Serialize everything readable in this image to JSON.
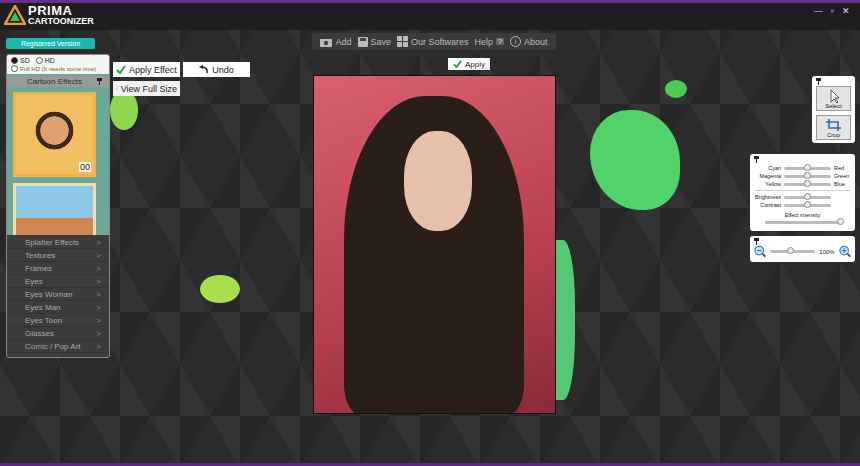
{
  "window": {
    "title_main": "PRIMA",
    "title_sub": "CARTOONIZER",
    "controls": [
      "—",
      "▫",
      "✕"
    ]
  },
  "toolbar": [
    {
      "label": "Add",
      "kind": "camera",
      "glyph": ""
    },
    {
      "label": "Save",
      "kind": "save",
      "glyph": ""
    },
    {
      "label": "Our Softwares",
      "kind": "apps",
      "glyph": ""
    },
    {
      "label": "Help",
      "kind": "help",
      "glyph": "?"
    },
    {
      "label": "About",
      "kind": "about",
      "glyph": "i"
    }
  ],
  "registered": "Registered Version",
  "quality": [
    {
      "label": "SD",
      "selected": true
    },
    {
      "label": "HD",
      "selected": false
    },
    {
      "label": "Full HD (It needs some time)",
      "selected": false
    }
  ],
  "effects_header": "Cartoon Effects",
  "thumbnails": [
    {
      "kind": "portrait",
      "badge": "00",
      "selected": true
    },
    {
      "kind": "town",
      "badge": "",
      "selected": false
    }
  ],
  "category_arrow": ">",
  "categories": [
    "Splatter Effects",
    "Textures",
    "Frames",
    "Eyes",
    "Eyes Woman",
    "Eyes Man",
    "Eyes Toon",
    "Glasses",
    "Comic / Pop Art"
  ],
  "actions": {
    "apply_effect": "Apply Effect",
    "undo": "Undo",
    "view_full_size": "View Full Size",
    "apply": "Apply"
  },
  "tools": [
    {
      "label": "Select",
      "kind": "select"
    },
    {
      "label": "Crop",
      "kind": "crop"
    }
  ],
  "color_balance": [
    {
      "left": "Cyan",
      "right": "Red",
      "level": 0.5
    },
    {
      "left": "Magenta",
      "right": "Green",
      "level": 0.5
    },
    {
      "left": "Yellow",
      "right": "Blue",
      "level": 0.5
    }
  ],
  "adjustments": [
    {
      "label": "Brightness",
      "level": 0.5
    },
    {
      "label": "Contrast",
      "level": 0.5
    }
  ],
  "intensity": {
    "label": "Effect intensity",
    "level": 1
  },
  "zoom": {
    "level": 0.45,
    "reading": "100%"
  }
}
